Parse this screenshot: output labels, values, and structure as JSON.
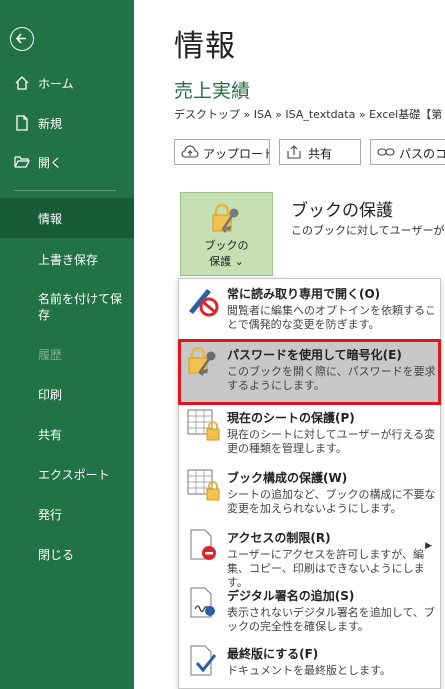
{
  "sidebar": {
    "back_label": "戻る",
    "items": [
      {
        "label": "ホーム",
        "icon": "home-icon"
      },
      {
        "label": "新規",
        "icon": "new-document-icon"
      },
      {
        "label": "開く",
        "icon": "open-folder-icon"
      },
      {
        "label": "情報",
        "active": true
      },
      {
        "label": "上書き保存"
      },
      {
        "label": "名前を付けて保存"
      },
      {
        "label": "履歴",
        "disabled": true
      },
      {
        "label": "印刷"
      },
      {
        "label": "共有"
      },
      {
        "label": "エクスポート"
      },
      {
        "label": "発行"
      },
      {
        "label": "閉じる"
      }
    ]
  },
  "main": {
    "title": "情報",
    "doc_title": "売上実績",
    "breadcrumb": "デスクトップ » ISA » ISA_textdata » Excel基礎【第",
    "toolbar": {
      "upload": "アップロード",
      "share": "共有",
      "copy_path": "パスのコピー"
    },
    "protect_button": {
      "line1": "ブックの",
      "line2": "保護 ⌄"
    },
    "section_title": "ブックの保護",
    "section_desc": "このブックに対してユーザーが実行"
  },
  "menu": {
    "items": [
      {
        "title": "常に読み取り専用で開く(O)",
        "desc": "閲覧者に編集へのオプトインを依頼することで偶発的な変更を防ぎます。",
        "icon": "read-only-icon"
      },
      {
        "title": "パスワードを使用して暗号化(E)",
        "desc": "このブックを開く際に、パスワードを要求するようにします。",
        "icon": "lock-key-icon",
        "highlighted": true
      },
      {
        "title": "現在のシートの保護(P)",
        "desc": "現在のシートに対してユーザーが行える変更の種類を管理します。",
        "icon": "sheet-lock-icon"
      },
      {
        "title": "ブック構成の保護(W)",
        "desc": "シートの追加など、ブックの構成に不要な変更を加えられないようにします。",
        "icon": "workbook-lock-icon"
      },
      {
        "title": "アクセスの制限(R)",
        "desc": "ユーザーにアクセスを許可しますが、編集、コピー、印刷はできないようにします。",
        "icon": "restrict-access-icon",
        "has_submenu": true
      },
      {
        "title": "デジタル署名の追加(S)",
        "desc": "表示されないデジタル署名を追加して、ブックの完全性を確保します。",
        "icon": "digital-signature-icon"
      },
      {
        "title": "最終版にする(F)",
        "desc": "ドキュメントを最終版とします。",
        "icon": "mark-final-icon"
      }
    ]
  },
  "colors": {
    "excel_green": "#217346",
    "active_green": "#185c37",
    "highlight_border": "#e0141e"
  }
}
